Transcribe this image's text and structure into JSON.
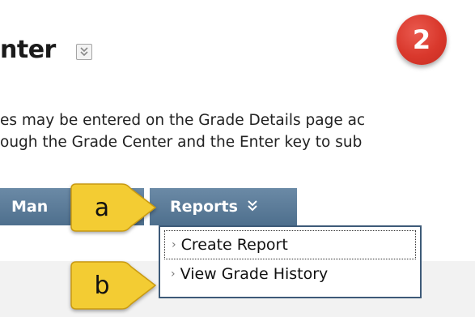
{
  "page": {
    "title": "nter",
    "instructions": [
      "es may be entered on the Grade Details page ac",
      "ough the Grade Center and the Enter key to sub"
    ]
  },
  "step_badge": {
    "number": "2",
    "color": "#d9382c"
  },
  "action_bar": {
    "manage_label": "Man",
    "reports_label": "Reports",
    "tab_color": "#5b7b99"
  },
  "reports_menu": {
    "items": [
      {
        "label": "Create Report"
      },
      {
        "label": "View Grade History"
      }
    ]
  },
  "callouts": {
    "a": "a",
    "b": "b",
    "color": "#f3cc33"
  },
  "icons": {
    "title_menu": "double-chevron-down-icon",
    "reports_chevron": "double-chevron-down-icon",
    "menu_item": "chevron-right-icon"
  }
}
